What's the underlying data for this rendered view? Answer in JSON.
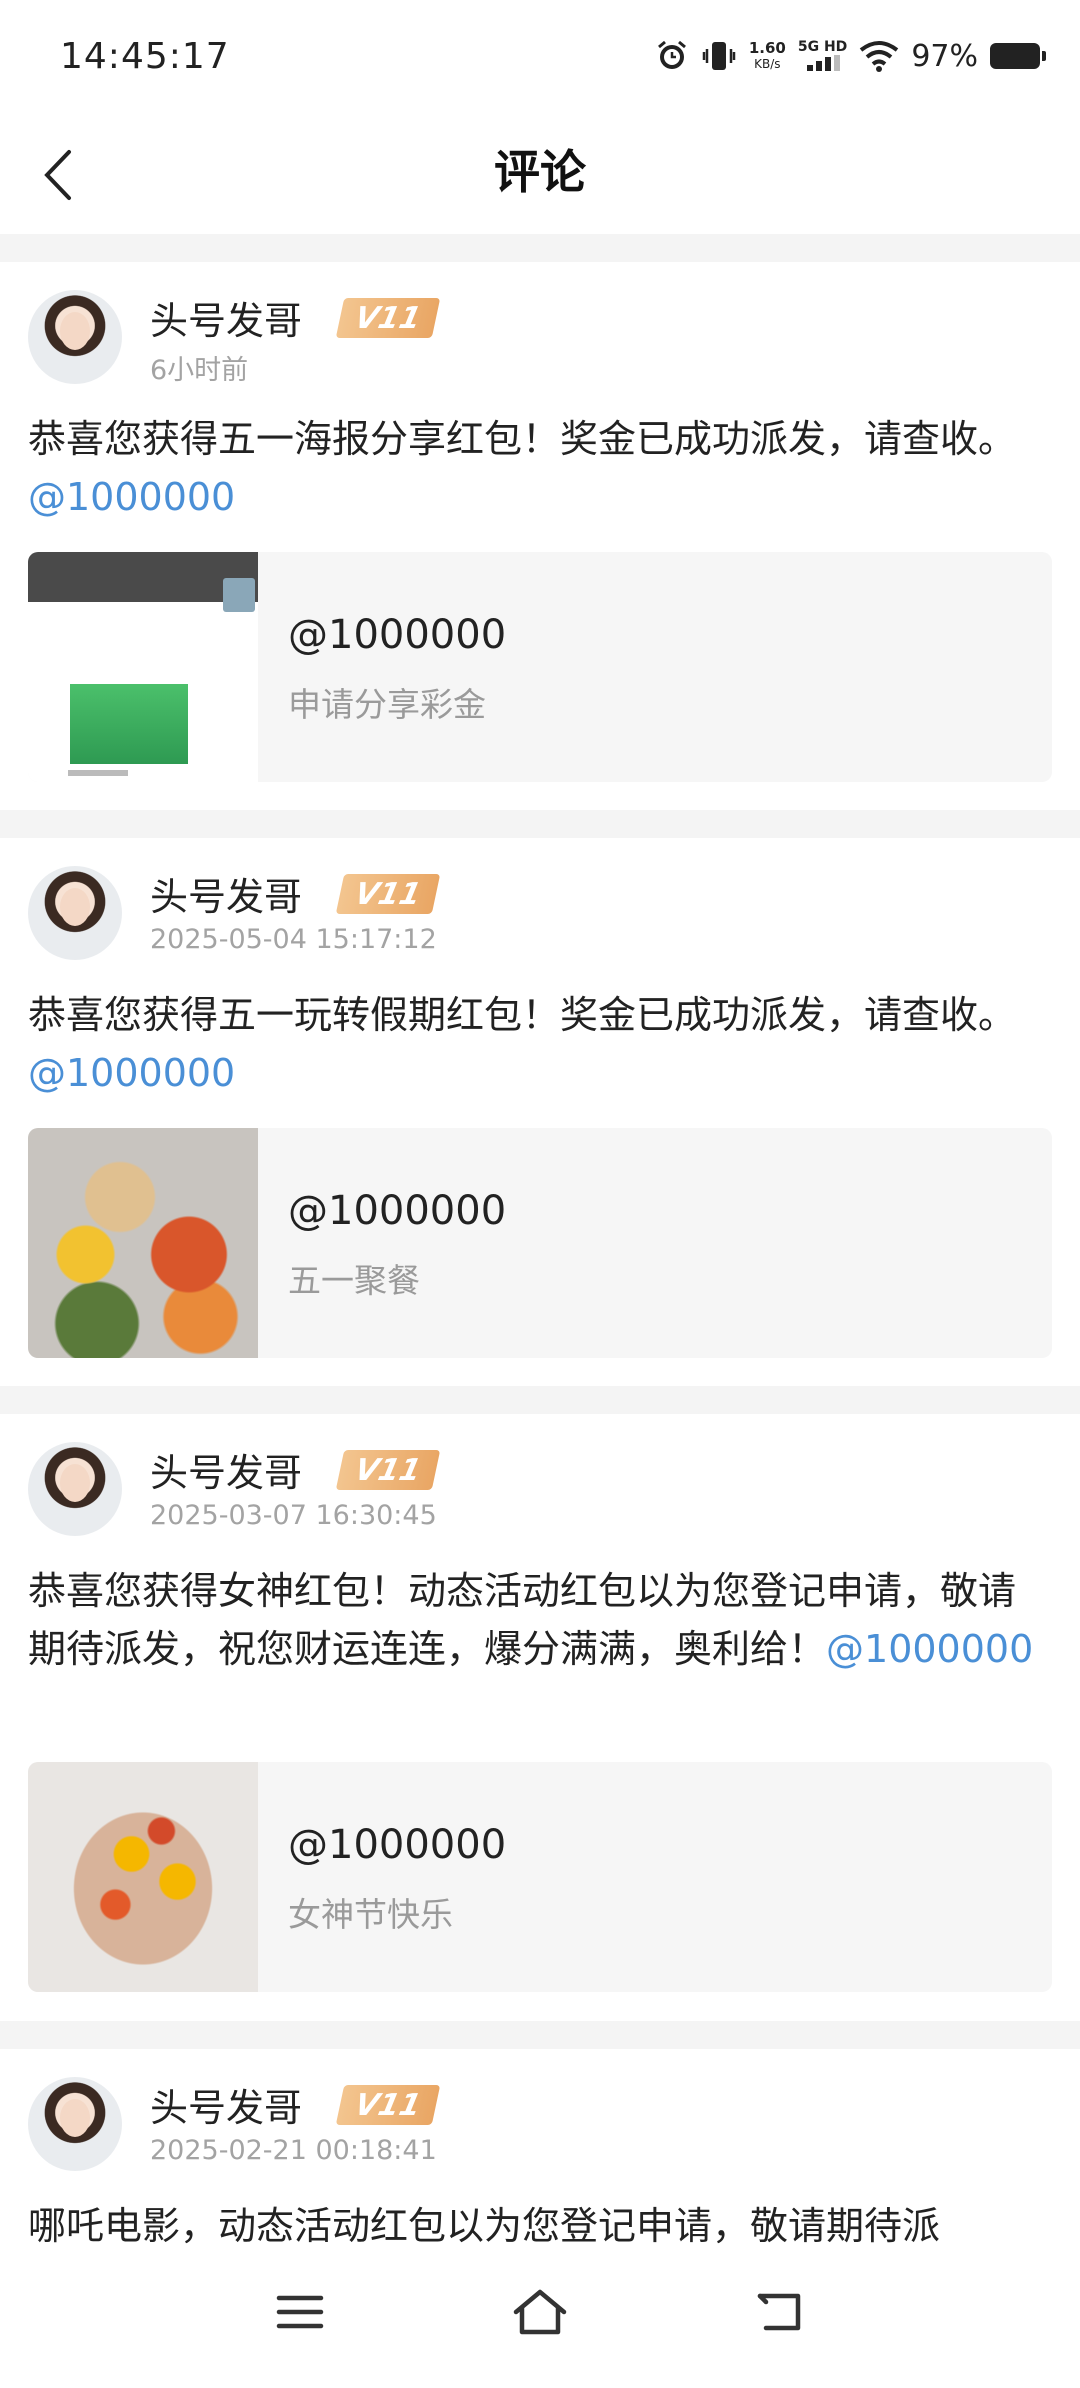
{
  "status_bar": {
    "time": "14:45:17",
    "net_speed": "1.60",
    "net_unit": "KB/s",
    "signal_label": "5G HD",
    "battery": "97%",
    "icons": [
      "alarm-icon",
      "vibrate-icon",
      "signal-icon",
      "wifi-icon",
      "battery-icon"
    ]
  },
  "header": {
    "title": "评论",
    "back_icon": "chevron-left-icon"
  },
  "comments": [
    {
      "username": "头号发哥",
      "level": "V11",
      "time": "6小时前",
      "text": "恭喜您获得五一海报分享红包！奖金已成功派发，请查收。",
      "mention": "@1000000",
      "preview_title": "@1000000",
      "preview_subtitle": "申请分享彩金"
    },
    {
      "username": "头号发哥",
      "level": "V11",
      "time": "2025-05-04 15:17:12",
      "text": "恭喜您获得五一玩转假期红包！奖金已成功派发，请查收。",
      "mention": "@1000000",
      "preview_title": "@1000000",
      "preview_subtitle": "五一聚餐"
    },
    {
      "username": "头号发哥",
      "level": "V11",
      "time": "2025-03-07 16:30:45",
      "text": "恭喜您获得女神红包！动态活动红包以为您登记申请，敬请期待派发，祝您财运连连，爆分满满，奥利给！",
      "mention": "@1000000",
      "preview_title": "@1000000",
      "preview_subtitle": "女神节快乐"
    },
    {
      "username": "头号发哥",
      "level": "V11",
      "time": "2025-02-21 00:18:41",
      "text": "哪吒电影，动态活动红包以为您登记申请，敬请期待派"
    }
  ],
  "colors": {
    "mention": "#4a8fd6",
    "badge": "#e9a664",
    "background": "#f4f4f4"
  },
  "bottom_nav": {
    "icons": [
      "menu-icon",
      "home-icon",
      "back-icon"
    ]
  }
}
